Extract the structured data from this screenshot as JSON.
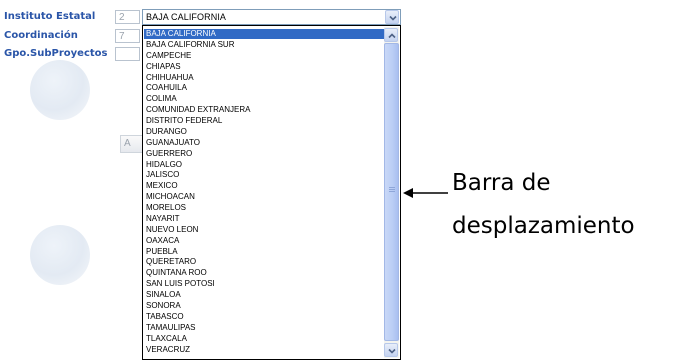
{
  "form": {
    "labels": [
      "Instituto Estatal",
      "Coordinación",
      "Gpo.SubProyectos"
    ],
    "codes": [
      "2",
      "7",
      ""
    ],
    "selected_value": "BAJA CALIFORNIA",
    "partial_button_text": "A"
  },
  "dropdown": {
    "options": [
      "BAJA CALIFORNIA",
      "BAJA CALIFORNIA SUR",
      "CAMPECHE",
      "CHIAPAS",
      "CHIHUAHUA",
      "COAHUILA",
      "COLIMA",
      "COMUNIDAD EXTRANJERA",
      "DISTRITO FEDERAL",
      "DURANGO",
      "GUANAJUATO",
      "GUERRERO",
      "HIDALGO",
      "JALISCO",
      "MEXICO",
      "MICHOACAN",
      "MORELOS",
      "NAYARIT",
      "NUEVO LEON",
      "OAXACA",
      "PUEBLA",
      "QUERETARO",
      "QUINTANA ROO",
      "SAN LUIS POTOSI",
      "SINALOA",
      "SONORA",
      "TABASCO",
      "TAMAULIPAS",
      "TLAXCALA",
      "VERACRUZ"
    ],
    "selected_index": 0
  },
  "annotation": {
    "line1": "Barra de",
    "line2": "desplazamiento"
  },
  "colors": {
    "label_blue": "#2a55a8",
    "selection_blue": "#316ac5",
    "scroll_thumb": "#b9cdf5"
  },
  "icons": [
    "chevron-down-icon",
    "chevron-up-icon",
    "arrow-left-icon"
  ]
}
